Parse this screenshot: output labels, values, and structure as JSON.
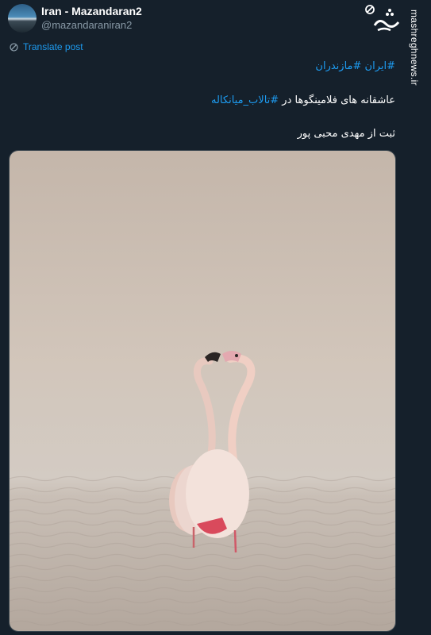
{
  "account": {
    "name": "Iran - Mazandaran2",
    "handle": "@mazandaraniran2"
  },
  "translate": {
    "label": "Translate post",
    "icon": "translate-icon"
  },
  "tweet": {
    "line1": {
      "hashtag_a": "#ایران",
      "sep": " ",
      "hashtag_b": "#مازندران"
    },
    "line2": {
      "text": "عاشقانه های فلامینگوها در ",
      "hashtag": "#تالاب_میانکاله"
    },
    "line3": {
      "text": "ثبت از مهدی محبی پور"
    }
  },
  "media": {
    "description_icon": "photo-two-flamingos"
  },
  "watermark": {
    "site": "mashreghnews.ir",
    "logo_text": "مشرق"
  },
  "colors": {
    "background": "#15202b",
    "link": "#1d9bf0",
    "secondary_text": "#8899a6"
  }
}
